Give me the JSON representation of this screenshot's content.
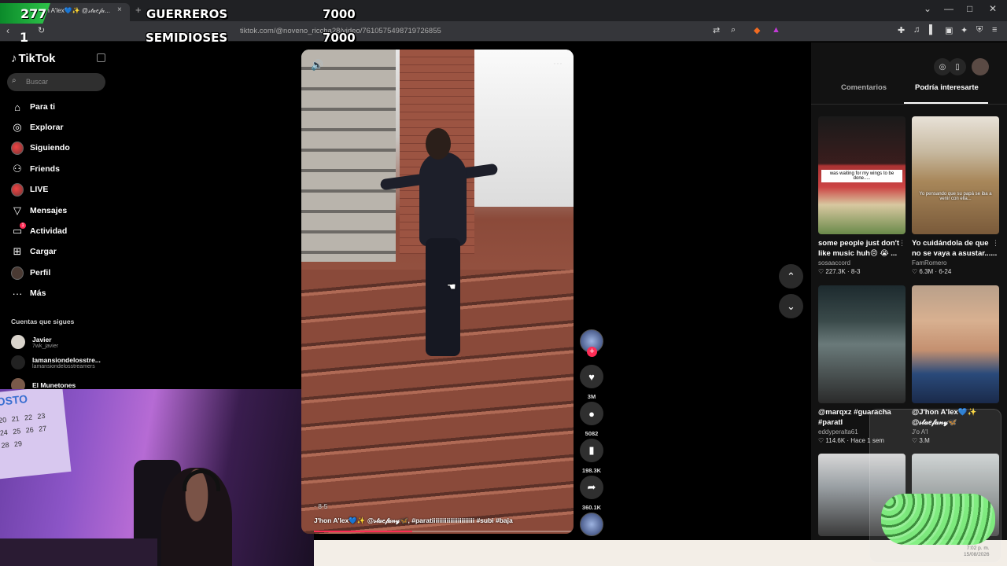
{
  "browser": {
    "tab_title": "J'hon A'lex💙✨ @𝓈𝓉𝒶𝑒𝒻𝒶...",
    "tab_close": "×",
    "new_tab": "+",
    "url": "tiktok.com/@noveno_riccha28/video/7610575498719726855",
    "win_minimize": "—",
    "win_maximize": "□",
    "win_close": "✕",
    "chevron": "⌄"
  },
  "overlay": {
    "badge_number": "277",
    "rank_number": "1",
    "team1_name": "GUERREROS",
    "team1_score": "7000",
    "team2_name": "SEMIDIOSES",
    "team2_score": "7000"
  },
  "sidebar": {
    "logo": "TikTok",
    "search_placeholder": "Buscar",
    "items": [
      {
        "label": "Para ti",
        "icon": "home-icon"
      },
      {
        "label": "Explorar",
        "icon": "compass-icon"
      },
      {
        "label": "Siguiendo",
        "icon": "avatar"
      },
      {
        "label": "Friends",
        "icon": "friends-icon"
      },
      {
        "label": "LIVE",
        "icon": "live-icon"
      },
      {
        "label": "Mensajes",
        "icon": "send-icon"
      },
      {
        "label": "Actividad",
        "icon": "inbox-icon"
      },
      {
        "label": "Cargar",
        "icon": "upload-icon"
      },
      {
        "label": "Perfil",
        "icon": "profile-icon"
      },
      {
        "label": "Más",
        "icon": "more-icon"
      }
    ],
    "activity_badge": "1",
    "following_title": "Cuentas que sigues",
    "following": [
      {
        "name": "Javier",
        "handle": "7wk_javier"
      },
      {
        "name": "lamansiondelosstre...",
        "handle": "lamansiondelosstreamers"
      },
      {
        "name": "El Munetones",
        "handle": ""
      }
    ]
  },
  "webcam": {
    "calendar_month": "OSTO",
    "calendar_days": "20 21 22 23 24 25 26 27 28 29"
  },
  "video": {
    "caption_meta": "· 8-5",
    "caption": "J'hon A'lex💙✨ @𝓈𝓉𝒶𝑒𝒻𝒶𝓃𝓎🦋, #paratiiiiiiiiiiiiiiiiiiiiiii #subi #baja",
    "progress": 0.38
  },
  "actions": {
    "likes": "3M",
    "comments": "5082",
    "saves": "198.3K",
    "shares": "360.1K",
    "plus": "+"
  },
  "right_panel": {
    "tab_comments": "Comentarios",
    "tab_suggested": "Podría interesarte",
    "cards": [
      {
        "title": "some people just don't like music huh😠 😭 ...",
        "author": "sosaaccord",
        "likes": "227.3K",
        "date": "8-3",
        "thumb_caption": "was waiting for my wings to be done....."
      },
      {
        "title": "Yo cuidándola de que no se vaya a asustar......",
        "author": "FamRomero",
        "likes": "6.3M",
        "date": "6-24",
        "thumb_caption": "Yo pensando que su papá se iba a venir con ella..."
      },
      {
        "title": "@marqxz #guaracha #paratI",
        "author": "eddyperalta61",
        "likes": "114.6K",
        "date": "Hace 1 sem",
        "thumb_caption": ""
      },
      {
        "title": "@J'hon A'lex💙✨ @𝓈𝓉𝒶𝑒𝒻𝒶𝓃𝓎🦋",
        "author": "J'o A'l",
        "likes": "3.M",
        "date": "",
        "thumb_caption": ""
      }
    ]
  },
  "clock": {
    "time": "7:02 p. m.",
    "date": "15/08/2026"
  },
  "colors": {
    "accent": "#fe2c55",
    "background": "#000000",
    "panel": "#121212"
  }
}
